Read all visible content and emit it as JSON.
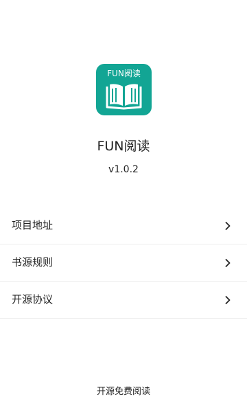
{
  "app": {
    "logo_label": "FUN阅读",
    "logo_icon": "open-book-icon",
    "name": "FUN阅读",
    "version": "v1.0.2",
    "brand_color": "#12a594"
  },
  "menu": {
    "items": [
      {
        "label": "项目地址",
        "icon": "chevron-right-icon"
      },
      {
        "label": "书源规则",
        "icon": "chevron-right-icon"
      },
      {
        "label": "开源协议",
        "icon": "chevron-right-icon"
      }
    ]
  },
  "footer": {
    "text": "开源免费阅读"
  }
}
